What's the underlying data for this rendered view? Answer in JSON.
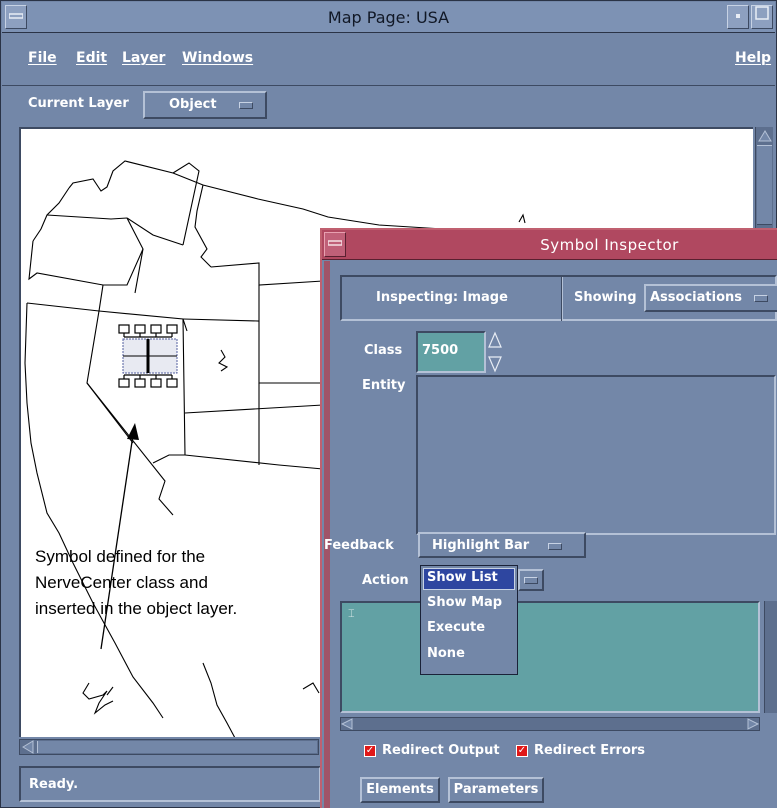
{
  "window": {
    "title": "Map Page: USA"
  },
  "menubar": {
    "items": [
      "File",
      "Edit",
      "Layer",
      "Windows"
    ],
    "help": "Help"
  },
  "layer_bar": {
    "label": "Current Layer",
    "value": "Object"
  },
  "map": {
    "annotation_lines": [
      "Symbol defined for the",
      "NerveCenter class and",
      "inserted in the object layer."
    ]
  },
  "status": {
    "text": "Ready."
  },
  "inspector": {
    "title": "Symbol Inspector",
    "inspecting_label": "Inspecting: Image",
    "showing_label": "Showing",
    "showing_value": "Associations",
    "class_label": "Class",
    "class_value": "7500",
    "entity_label": "Entity",
    "feedback_label": "Feedback",
    "feedback_value": "Highlight Bar",
    "action_label": "Action",
    "action_options": [
      "Show List",
      "Show Map",
      "Execute",
      "None"
    ],
    "action_selected": "Show List",
    "redirect_output_label": "Redirect Output",
    "redirect_output_checked": true,
    "redirect_errors_label": "Redirect Errors",
    "redirect_errors_checked": true,
    "elements_button": "Elements",
    "parameters_button": "Parameters"
  },
  "colors": {
    "motif_bg": "#7387a8",
    "inspector_title": "#b04860",
    "text_field": "#62a1a4",
    "checkbox": "#e01818",
    "action_highlight": "#2e46a0"
  }
}
